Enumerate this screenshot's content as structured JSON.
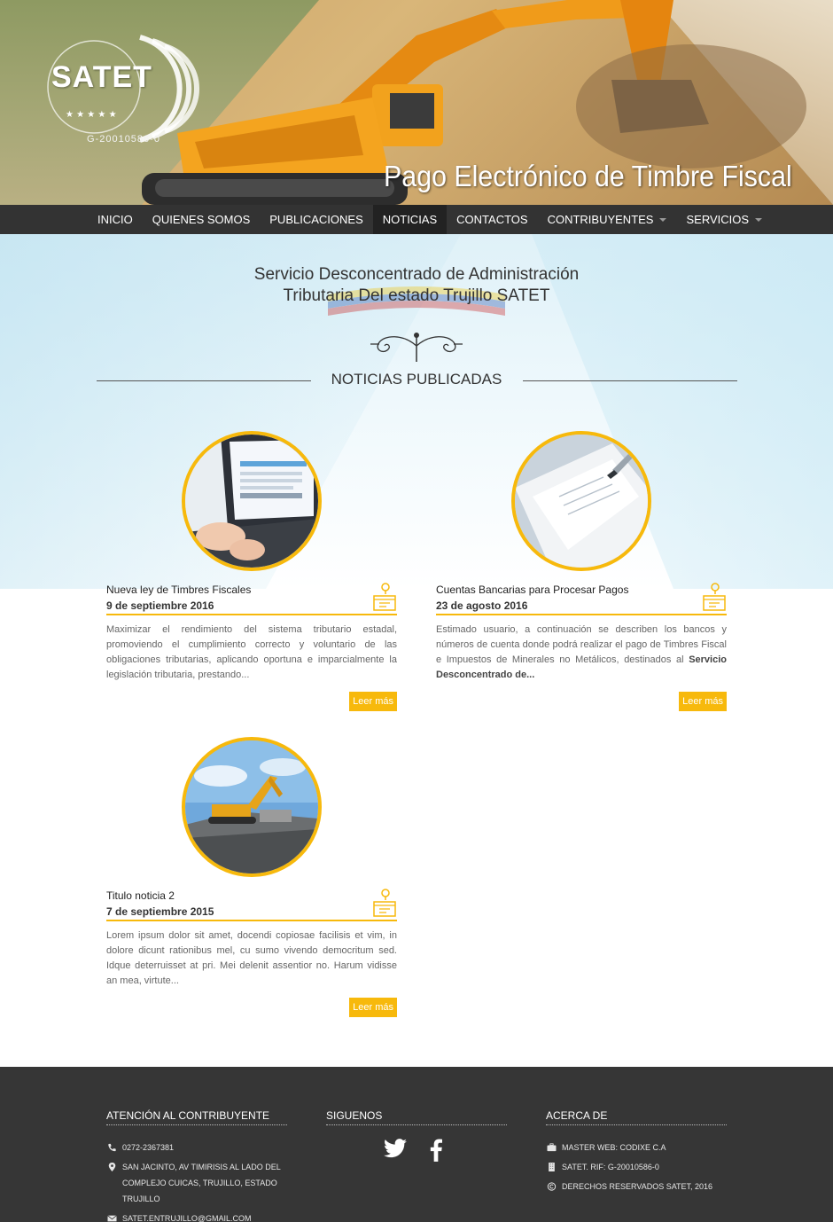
{
  "header": {
    "logo_text": "SATET",
    "logo_rif": "G-20010586-0",
    "title": "Pago Electrónico de Timbre Fiscal"
  },
  "nav": {
    "items": [
      {
        "label": "INICIO"
      },
      {
        "label": "QUIENES SOMOS"
      },
      {
        "label": "PUBLICACIONES"
      },
      {
        "label": "NOTICIAS"
      },
      {
        "label": "CONTACTOS"
      },
      {
        "label": "CONTRIBUYENTES"
      },
      {
        "label": "SERVICIOS"
      }
    ],
    "active": "NOTICIAS"
  },
  "intro": {
    "line1": "Servicio Desconcentrado de Administración",
    "line2": "Tributaria Del estado Trujillo SATET",
    "section_title": "NOTICIAS PUBLICADAS"
  },
  "news": [
    {
      "title": "Nueva ley de Timbres Fiscales",
      "date": "9 de septiembre 2016",
      "excerpt": "Maximizar el rendimiento del sistema tributario estadal, promoviendo el cumplimiento correcto y voluntario de las obligaciones tributarias, aplicando oportuna e imparcialmente la legislación tributaria, prestando...",
      "excerpt_bold": "",
      "more": "Leer más",
      "image_icon": "laptop-photo"
    },
    {
      "title": "Cuentas Bancarias para Procesar Pagos",
      "date": "23 de agosto 2016",
      "excerpt": "Estimado usuario, a continuación se describen los bancos y números de cuenta donde podrá realizar el pago de Timbres Fiscal e Impuestos de Minerales no Metálicos, destinados al",
      "excerpt_bold": "Servicio Desconcentrado de...",
      "more": "Leer más",
      "image_icon": "document-pen-photo"
    },
    {
      "title": "Titulo noticia 2",
      "date": "7 de septiembre 2015",
      "excerpt": "Lorem ipsum dolor sit amet, docendi copiosae facilisis et vim, in dolore dicunt rationibus mel, cu sumo vivendo democritum sed. Idque deterruisset at pri. Mei delenit assentior no. Harum vidisse an mea, virtute...",
      "excerpt_bold": "",
      "more": "Leer más",
      "image_icon": "excavator-photo"
    }
  ],
  "footer": {
    "contact": {
      "heading": "ATENCIÓN AL CONTRIBUYENTE",
      "phone": "0272-2367381",
      "address": "SAN JACINTO, AV TIMIRISIS AL LADO DEL COMPLEJO CUICAS, TRUJILLO, ESTADO TRUJILLO",
      "email": "SATET.ENTRUJILLO@GMAIL.COM"
    },
    "social": {
      "heading": "SIGUENOS",
      "icons": [
        "twitter-icon",
        "facebook-icon"
      ]
    },
    "about": {
      "heading": "ACERCA DE",
      "master": "MASTER WEB: CODIXE C.A",
      "rif": "SATET. RIF: G-20010586-0",
      "rights": "DERECHOS RESERVADOS SATET, 2016"
    }
  },
  "colors": {
    "accent": "#f7b90c",
    "nav_bg": "#333333",
    "footer_bg": "#363636"
  }
}
